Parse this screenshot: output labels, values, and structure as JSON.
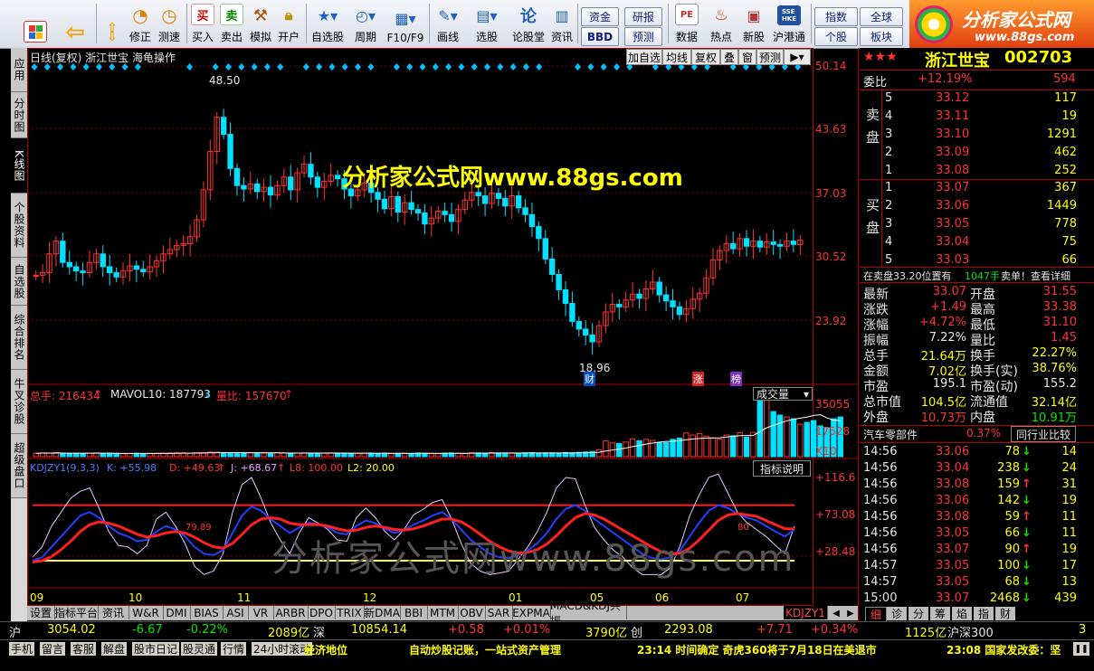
{
  "toolbar": {
    "buttons": [
      {
        "label": "",
        "icon": "home-icon",
        "color": "#d22"
      },
      {
        "label": "",
        "icon": "back-arrow-icon",
        "color": "#f0a000"
      },
      {
        "label": "修正",
        "icon": "updown-arrows-icon",
        "color": "#f0a000"
      },
      {
        "label": "测速",
        "icon": "speedometer-icon",
        "color": "#e08000"
      },
      {
        "label": "买入",
        "icon": "buy-icon",
        "color": "#d00"
      },
      {
        "label": "卖出",
        "icon": "sell-icon",
        "color": "#080"
      },
      {
        "label": "模拟",
        "icon": "gavel-icon",
        "color": "#b05000"
      },
      {
        "label": "开户",
        "icon": "lock-icon",
        "color": "#c09000"
      },
      {
        "label": "自选股",
        "icon": "star-icon",
        "color": "#2060c0"
      },
      {
        "label": "周期",
        "icon": "clock-icon",
        "color": "#2060c0"
      },
      {
        "label": "F10/F9",
        "icon": "grid-icon",
        "color": "#2060c0"
      },
      {
        "label": "画线",
        "icon": "pencil-icon",
        "color": "#2060c0"
      },
      {
        "label": "选股",
        "icon": "chart-icon",
        "color": "#2060c0"
      },
      {
        "label": "论股堂",
        "icon": "lun-icon",
        "color": "#2060c0"
      },
      {
        "label": "资讯",
        "icon": "news-icon",
        "color": "#2060c0"
      },
      {
        "label": "数据",
        "icon": "pe-icon",
        "color": "#c03030"
      },
      {
        "label": "热点",
        "icon": "hot-icon",
        "color": "#e03000"
      },
      {
        "label": "新股",
        "icon": "newstock-icon",
        "color": "#c03030"
      },
      {
        "label": "沪港通",
        "icon": "sse-hke-icon",
        "color": "#2050a0"
      }
    ],
    "pills": {
      "zijin": "资金",
      "yanbao": "研报",
      "bbd": "BBD",
      "yuce": "预测",
      "zhishu": "指数",
      "quanqiu": "全球",
      "gegu": "个股",
      "bankuai": "板块"
    },
    "brand": "分析家公式网",
    "brand_url": "www.88gs.com"
  },
  "left_tabs": [
    {
      "label": "应用",
      "active": false
    },
    {
      "label": "分时图",
      "active": false
    },
    {
      "label": "K线图",
      "active": true
    },
    {
      "label": "个股资料",
      "active": false
    },
    {
      "label": "自选股",
      "active": false
    },
    {
      "label": "综合排名",
      "active": false
    },
    {
      "label": "牛叉诊股",
      "active": false
    },
    {
      "label": "超级盘口",
      "active": false
    }
  ],
  "chart": {
    "header": "日线(复权)  浙江世宝  海龟操作",
    "buttons": [
      "加自选",
      "均线",
      "复权",
      "叠",
      "窗",
      "预测"
    ],
    "price_labels": [
      "50.14",
      "43.63",
      "37.03",
      "30.52",
      "23.92"
    ],
    "high_note": "48.50",
    "low_note": "18.96",
    "badges": {
      "cai": "财",
      "zhang": "涨",
      "bang": "榜"
    },
    "watermark_top": "分析家公式网www.88gs.com",
    "watermark_bottom": "分析家公式网www.88gs.com",
    "volume": {
      "total_label": "总手: 216434",
      "mavol": "MAVOL10: 187793",
      "liangbi": "量比: 157670",
      "selector": "成交量",
      "levels": [
        "35055",
        "17528",
        "X10"
      ]
    },
    "kdj": {
      "title": "KDJZY1(9,3,3)",
      "k": "K: +55.98",
      "d": "D: +49.63",
      "j": "J: +68.67",
      "l8": "L8: 100.00",
      "l2": "L2: 20.00",
      "explain": "指标说明",
      "levels": [
        "+116.6",
        "+73.08",
        "+28.48"
      ],
      "note1": "79.89",
      "note2": "80"
    },
    "months": [
      "09",
      "10",
      "11",
      "12",
      "01",
      "05",
      "06",
      "07"
    ]
  },
  "chart_data": {
    "type": "candlestick",
    "closes": [
      27.5,
      27.8,
      30,
      31.5,
      29,
      28.5,
      28,
      27.8,
      29,
      30,
      28.5,
      27.8,
      27.3,
      28,
      28.6,
      28.2,
      27.9,
      28.5,
      29.2,
      30,
      30.5,
      31,
      31.2,
      32,
      34,
      37.5,
      42,
      46,
      44,
      40,
      38,
      37.6,
      38.2,
      37.3,
      37.8,
      36.9,
      38,
      39,
      37.5,
      39.5,
      40.5,
      39,
      37.8,
      38.5,
      39.2,
      38.8,
      37.6,
      36.8,
      37.5,
      38.3,
      37.2,
      36.4,
      35.3,
      36.7,
      34.9,
      36,
      35.2,
      34.8,
      33.5,
      34.2,
      35,
      34.6,
      33.8,
      35.2,
      36.3,
      37.2,
      36.8,
      35.9,
      37.1,
      36.5,
      35.6,
      36.8,
      35.4,
      34.6,
      33.2,
      31.8,
      29.4,
      27.6,
      25.8,
      24.2,
      22.1,
      21.2,
      20.5,
      19.7,
      21.6,
      23.2,
      24.1,
      23.8,
      24.6,
      25.3,
      24.8,
      25.9,
      26.7,
      25.2,
      24.5,
      23.8,
      22.9,
      23.6,
      24.7,
      25.4,
      27.2,
      29.3,
      30.4,
      31.2,
      30.6,
      31.8,
      30.9,
      31.5,
      30.8,
      31.4,
      31.1,
      30.9,
      31.5,
      31.1,
      31.6
    ],
    "volumes_x10": [
      1900,
      2100,
      2000,
      2300,
      1700,
      1800,
      1900,
      1600,
      2000,
      2100,
      1800,
      1900,
      1700,
      1600,
      1800,
      1900,
      1700,
      1800,
      1900,
      2000,
      2100,
      2200,
      2100,
      2000,
      2200,
      2300,
      2600,
      2500,
      2300,
      2100,
      2000,
      1900,
      2100,
      2000,
      1900,
      2000,
      2200,
      2100,
      1900,
      2000,
      2100,
      2000,
      1800,
      1900,
      2100,
      2000,
      1900,
      1800,
      1800,
      1900,
      2000,
      1800,
      1900,
      1700,
      1800,
      1900,
      1800,
      2000,
      1900,
      1800,
      1700,
      2000,
      2100,
      1900,
      1800,
      2200,
      2100,
      2000,
      2300,
      2100,
      2000,
      1900,
      2000,
      2100,
      2200,
      2000,
      2100,
      2100,
      2000,
      2300,
      2100,
      2400,
      2600,
      2900,
      3800,
      8800,
      7600,
      7300,
      8100,
      9900,
      8800,
      9600,
      9000,
      7700,
      7800,
      9600,
      10300,
      13100,
      12000,
      12800,
      11400,
      10300,
      9700,
      12000,
      11600,
      13300,
      10800,
      13500,
      33000,
      34000,
      25000,
      23000,
      22000,
      21000,
      18000,
      19000,
      20000,
      17000,
      16000,
      21000,
      22000
    ],
    "k": [
      20,
      25,
      40,
      55,
      70,
      85,
      90,
      82,
      70,
      60,
      55,
      48,
      50,
      62,
      70,
      65,
      55,
      40,
      30,
      28,
      35,
      60,
      85,
      98,
      92,
      80,
      70,
      60,
      68,
      75,
      72,
      68,
      60,
      58,
      70,
      78,
      74,
      66,
      60,
      64,
      72,
      78,
      85,
      90,
      80,
      65,
      50,
      40,
      30,
      25,
      24,
      28,
      35,
      45,
      60,
      80,
      95,
      100,
      92,
      80,
      70,
      60,
      50,
      40,
      30,
      24,
      22,
      25,
      35,
      55,
      75,
      92,
      100,
      96,
      88,
      82,
      78,
      70,
      62,
      55,
      65
    ],
    "d": [
      18,
      20,
      26,
      36,
      48,
      62,
      72,
      76,
      74,
      70,
      64,
      58,
      54,
      56,
      60,
      62,
      60,
      54,
      46,
      40,
      38,
      45,
      58,
      72,
      80,
      82,
      80,
      74,
      72,
      72,
      72,
      70,
      66,
      63,
      64,
      68,
      70,
      68,
      65,
      64,
      66,
      70,
      75,
      80,
      80,
      76,
      68,
      58,
      48,
      40,
      34,
      31,
      32,
      36,
      44,
      56,
      70,
      82,
      88,
      86,
      80,
      72,
      64,
      56,
      48,
      40,
      33,
      30,
      31,
      38,
      50,
      64,
      78,
      86,
      88,
      86,
      84,
      78,
      72,
      66,
      66
    ],
    "j": [
      25,
      40,
      70,
      90,
      110,
      120,
      125,
      95,
      62,
      42,
      40,
      30,
      42,
      80,
      90,
      70,
      45,
      12,
      0,
      5,
      30,
      90,
      130,
      140,
      110,
      75,
      50,
      30,
      60,
      82,
      74,
      65,
      50,
      48,
      82,
      96,
      82,
      62,
      50,
      65,
      86,
      94,
      104,
      108,
      80,
      45,
      16,
      5,
      0,
      2,
      5,
      22,
      40,
      62,
      90,
      125,
      140,
      138,
      100,
      68,
      50,
      35,
      25,
      10,
      0,
      0,
      0,
      10,
      42,
      85,
      115,
      140,
      145,
      118,
      90,
      75,
      65,
      55,
      42,
      30,
      70
    ],
    "axis_range": [
      16,
      52
    ]
  },
  "quote": {
    "stars": "★★★",
    "name": "浙江世宝",
    "code": "002703",
    "weibi_label": "委比",
    "weibi": "+12.19%",
    "weicha": "594",
    "sell_label": "卖盘",
    "buy_label": "买盘",
    "sell": [
      {
        "n": "5",
        "p": "33.12",
        "v": "117"
      },
      {
        "n": "4",
        "p": "33.11",
        "v": "19"
      },
      {
        "n": "3",
        "p": "33.10",
        "v": "1291"
      },
      {
        "n": "2",
        "p": "33.09",
        "v": "462"
      },
      {
        "n": "1",
        "p": "33.08",
        "v": "252"
      }
    ],
    "buy": [
      {
        "n": "1",
        "p": "33.07",
        "v": "367"
      },
      {
        "n": "2",
        "p": "33.06",
        "v": "1449"
      },
      {
        "n": "3",
        "p": "33.05",
        "v": "778"
      },
      {
        "n": "4",
        "p": "33.04",
        "v": "75"
      },
      {
        "n": "5",
        "p": "33.03",
        "v": "66"
      }
    ],
    "notice_a": "在卖盘33.20位置有",
    "notice_b": "1047手",
    "notice_c": "卖单！查看详细",
    "stats": [
      {
        "l1": "最新",
        "v1": "33.07",
        "c1": "red",
        "l2": "开盘",
        "v2": "31.55",
        "c2": "red"
      },
      {
        "l1": "涨跌",
        "v1": "+1.49",
        "c1": "red",
        "l2": "最高",
        "v2": "33.38",
        "c2": "red"
      },
      {
        "l1": "涨幅",
        "v1": "+4.72%",
        "c1": "red",
        "l2": "最低",
        "v2": "31.10",
        "c2": "red"
      },
      {
        "l1": "振幅",
        "v1": "7.22%",
        "c1": "wht",
        "l2": "量比",
        "v2": "1.45",
        "c2": "red"
      },
      {
        "l1": "总手",
        "v1": "21.64万",
        "c1": "yel",
        "l2": "换手",
        "v2": "22.27%",
        "c2": "yel"
      },
      {
        "l1": "金额",
        "v1": "7.02亿",
        "c1": "yel",
        "l2": "换手(实)",
        "v2": "38.76%",
        "c2": "yel"
      },
      {
        "l1": "市盈",
        "v1": "195.1",
        "c1": "wht",
        "l2": "市盈(动)",
        "v2": "155.2",
        "c2": "wht"
      },
      {
        "l1": "总市值",
        "v1": "104.5亿",
        "c1": "yel",
        "l2": "流通值",
        "v2": "32.14亿",
        "c2": "yel"
      },
      {
        "l1": "外盘",
        "v1": "10.73万",
        "c1": "red",
        "l2": "内盘",
        "v2": "10.91万",
        "c2": "grn"
      }
    ],
    "industry": "汽车零部件",
    "industry_pct": "0.37%",
    "compare": "同行业比较",
    "ticks": [
      {
        "t": "14:56",
        "p": "33.06",
        "v": "78",
        "d": "dn",
        "n": "14"
      },
      {
        "t": "14:56",
        "p": "33.04",
        "v": "238",
        "d": "dn",
        "n": "24"
      },
      {
        "t": "14:56",
        "p": "33.08",
        "v": "159",
        "d": "up",
        "n": "31"
      },
      {
        "t": "14:56",
        "p": "33.06",
        "v": "142",
        "d": "dn",
        "n": "19"
      },
      {
        "t": "14:56",
        "p": "33.08",
        "v": "59",
        "d": "up",
        "n": "11"
      },
      {
        "t": "14:56",
        "p": "33.05",
        "v": "66",
        "d": "dn",
        "n": "11"
      },
      {
        "t": "14:56",
        "p": "33.07",
        "v": "90",
        "d": "up",
        "n": "19"
      },
      {
        "t": "14:57",
        "p": "33.05",
        "v": "100",
        "d": "dn",
        "n": "17"
      },
      {
        "t": "14:57",
        "p": "33.05",
        "v": "68",
        "d": "dn",
        "n": "13"
      },
      {
        "t": "15:00",
        "p": "33.07",
        "v": "2468",
        "d": "dn",
        "n": "439"
      }
    ],
    "detail_tabs": [
      "细",
      "诊",
      "分",
      "筹",
      "焰",
      "指",
      "财"
    ]
  },
  "bottom_tabs": [
    "设置",
    "指标平台",
    "资讯",
    "W&R",
    "DMI",
    "BIAS",
    "ASI",
    "VR",
    "ARBR",
    "DPO",
    "TRIX",
    "新DMA",
    "BBI",
    "MTM",
    "OBV",
    "SAR",
    "EXPMA",
    "MACD&KDJ共振",
    "KDJZY1"
  ],
  "indexbar": {
    "sh": "沪",
    "sh_v": "3054.02",
    "sh_c": "-6.67",
    "sh_p": "-0.22%",
    "sh_a": "2089亿",
    "sz": "深",
    "sz_v": "10854.14",
    "sz_c": "+0.58",
    "sz_p": "+0.01%",
    "sz_a": "3790亿",
    "cy": "创",
    "cy_v": "2293.08",
    "cy_c": "+7.71",
    "cy_p": "+0.34%",
    "cy_a": "1125亿",
    "hs": "沪深300",
    "hs_v": "3"
  },
  "statusbar": {
    "items": [
      "手机",
      "留言",
      "客服",
      "解盘",
      "股市日记",
      "股灵通",
      "行情",
      "24小时滚动"
    ],
    "news1": "经济地位",
    "news2": "自动炒股记账，一站式资产管理",
    "news3": "23:14 时间确定 奇虎360将于7月18日在美退市",
    "news4": "23:08 国家发改委：坚"
  }
}
